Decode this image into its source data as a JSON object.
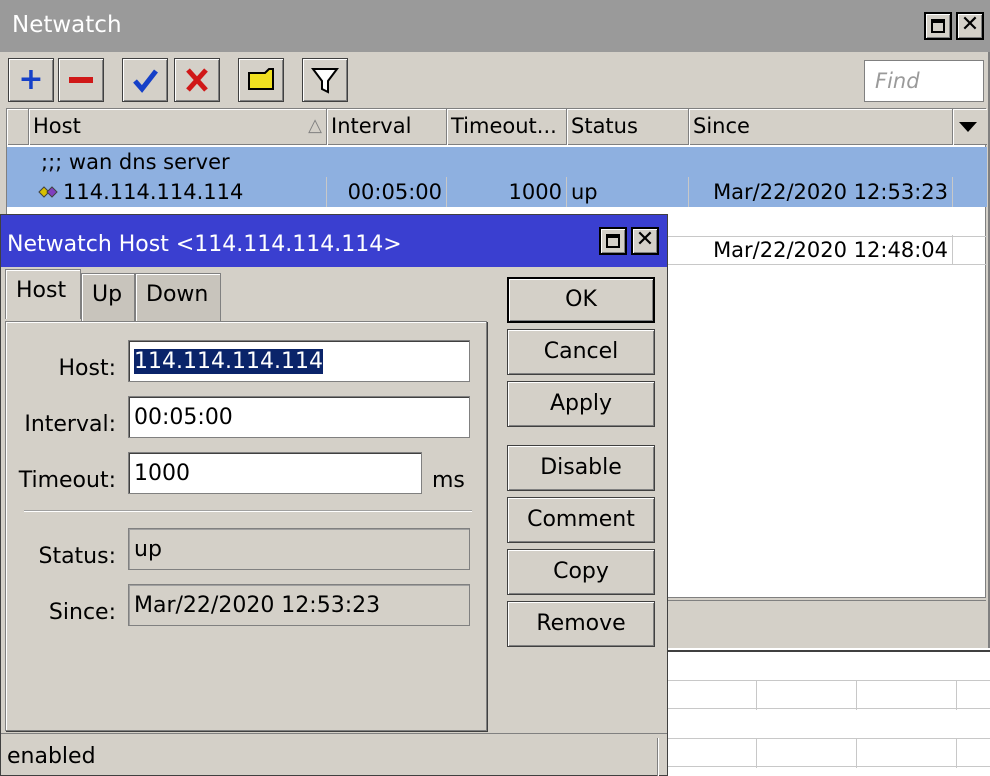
{
  "main_window": {
    "title": "Netwatch",
    "find_placeholder": "Find",
    "columns": [
      "Host",
      "Interval",
      "Timeout...",
      "Status",
      "Since"
    ],
    "comment_row": ";;; wan  dns  server",
    "rows": [
      {
        "host": "114.114.114.114",
        "interval": "00:05:00",
        "timeout": "1000",
        "status": "up",
        "since": "Mar/22/2020 12:53:23"
      },
      {
        "host": "",
        "interval": "",
        "timeout": "",
        "status": "",
        "since": "Mar/22/2020 12:48:04"
      }
    ],
    "toolbar_icons": [
      "add-icon",
      "remove-icon",
      "enable-icon",
      "disable-icon",
      "comment-icon",
      "filter-icon"
    ]
  },
  "dialog": {
    "title": "Netwatch Host <114.114.114.114>",
    "tabs": [
      "Host",
      "Up",
      "Down"
    ],
    "fields": {
      "host_label": "Host:",
      "host_value": "114.114.114.114",
      "interval_label": "Interval:",
      "interval_value": "00:05:00",
      "timeout_label": "Timeout:",
      "timeout_value": "1000",
      "timeout_unit": "ms",
      "status_label": "Status:",
      "status_value": "up",
      "since_label": "Since:",
      "since_value": "Mar/22/2020 12:53:23"
    },
    "buttons": {
      "ok": "OK",
      "cancel": "Cancel",
      "apply": "Apply",
      "disable": "Disable",
      "comment": "Comment",
      "copy": "Copy",
      "remove": "Remove"
    },
    "status_bar": "enabled"
  },
  "colors": {
    "selected_row": "#8eb0e0",
    "dialog_title": "#3a3fd0",
    "inactive_title": "#9a9a9a",
    "selection": "#0a246a"
  }
}
